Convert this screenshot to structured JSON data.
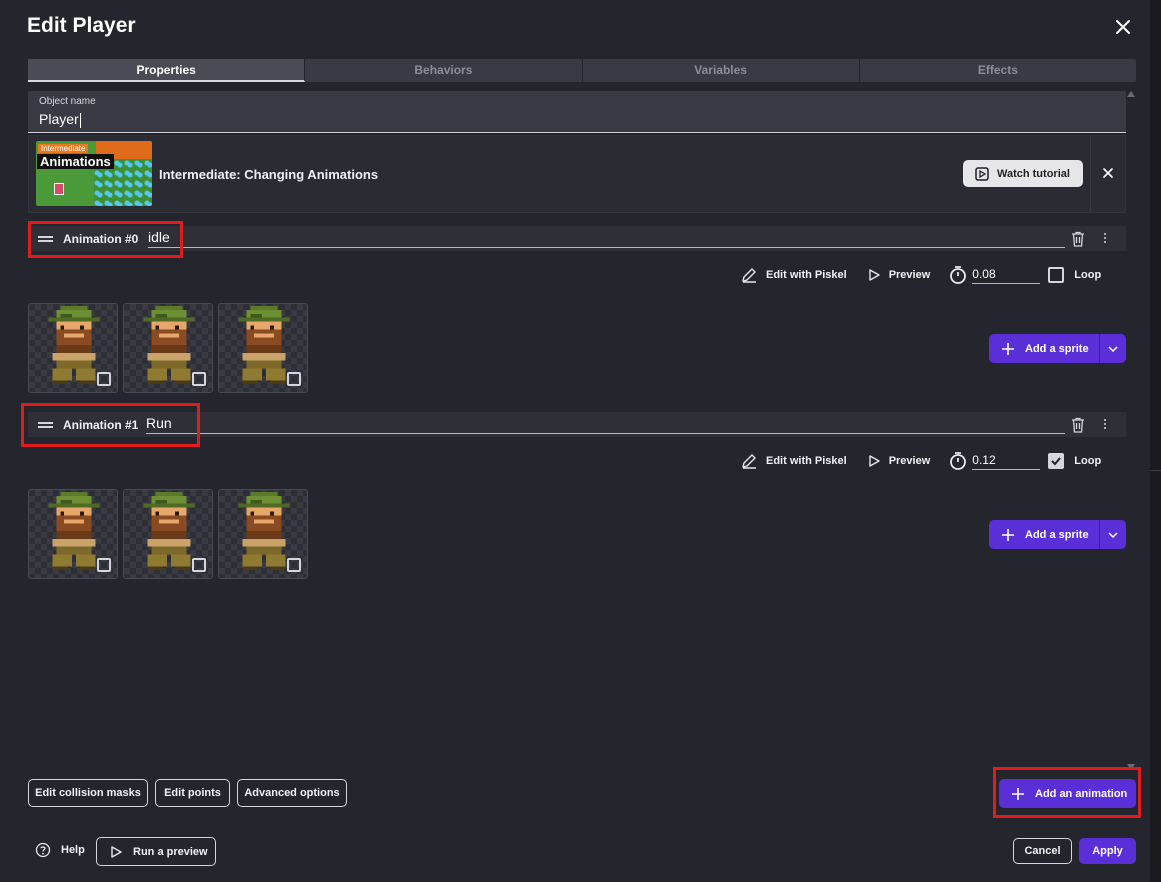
{
  "dialog": {
    "title": "Edit Player"
  },
  "tabs": [
    "Properties",
    "Behaviors",
    "Variables",
    "Effects"
  ],
  "object_name": {
    "label": "Object name",
    "value": "Player"
  },
  "tutorial": {
    "thumb_tag": "Intermediate",
    "thumb_title": "Animations",
    "title": "Intermediate: Changing Animations",
    "watch_label": "Watch tutorial"
  },
  "animations": [
    {
      "label": "Animation #0",
      "name": "idle",
      "edit_label": "Edit with Piskel",
      "preview_label": "Preview",
      "timer": "0.08",
      "loop_label": "Loop",
      "loop_checked": false,
      "add_sprite_label": "Add a sprite"
    },
    {
      "label": "Animation #1",
      "name": "Run",
      "edit_label": "Edit with Piskel",
      "preview_label": "Preview",
      "timer": "0.12",
      "loop_label": "Loop",
      "loop_checked": true,
      "add_sprite_label": "Add a sprite"
    }
  ],
  "footer": {
    "edit_collision_masks": "Edit collision masks",
    "edit_points": "Edit points",
    "advanced_options": "Advanced options",
    "add_animation": "Add an animation",
    "help": "Help",
    "run_preview": "Run a preview",
    "cancel": "Cancel",
    "apply": "Apply"
  },
  "colors": {
    "accent": "#5b2fd8",
    "highlight": "#e11c1c",
    "background": "#25252d"
  }
}
